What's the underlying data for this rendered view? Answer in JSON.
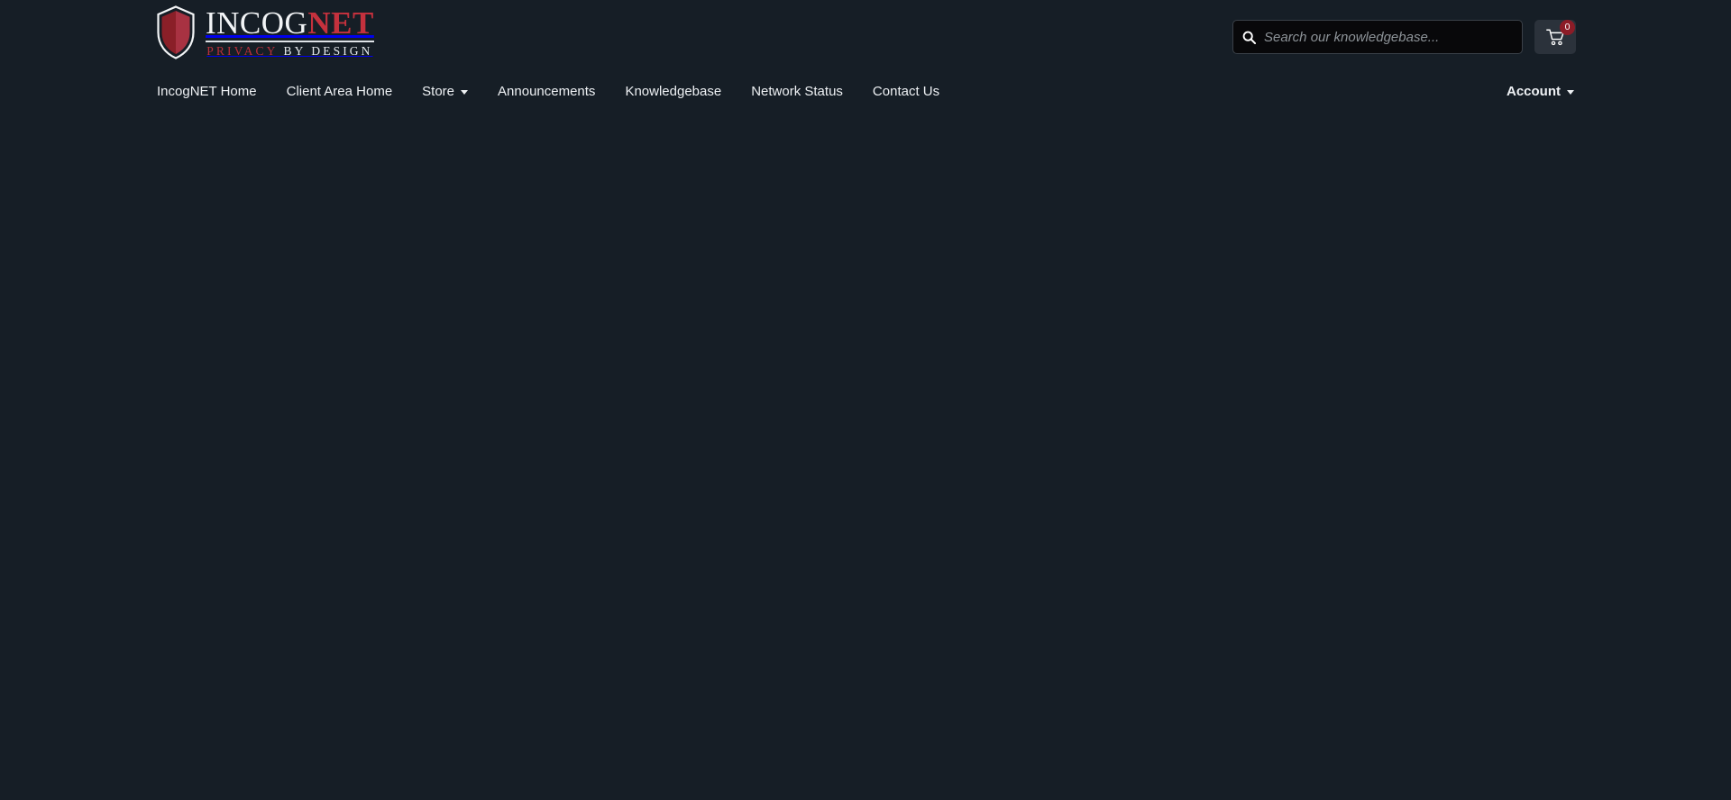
{
  "colors": {
    "page_background": "#161e26",
    "brand_red": "#c4313d",
    "accent_dark_red": "#8c1c27",
    "nav_text": "#eef1f4",
    "search_background": "#08080a",
    "cart_button_background": "#2b323b"
  },
  "header": {
    "logo": {
      "icon": "shield-icon",
      "wordmark_light": "INCOG",
      "wordmark_red": "NET",
      "tagline_red": "PRIVACY",
      "tagline_light": "BY DESIGN"
    },
    "search": {
      "icon": "search-icon",
      "placeholder": "Search our knowledgebase...",
      "value": ""
    },
    "cart": {
      "icon": "shopping-cart-icon",
      "badge_count": "0"
    }
  },
  "nav": {
    "items": [
      {
        "label": "IncogNET Home",
        "has_dropdown": false
      },
      {
        "label": "Client Area Home",
        "has_dropdown": false
      },
      {
        "label": "Store",
        "has_dropdown": true
      },
      {
        "label": "Announcements",
        "has_dropdown": false
      },
      {
        "label": "Knowledgebase",
        "has_dropdown": false
      },
      {
        "label": "Network Status",
        "has_dropdown": false
      },
      {
        "label": "Contact Us",
        "has_dropdown": false
      }
    ],
    "account": {
      "label": "Account",
      "has_dropdown": true
    }
  }
}
